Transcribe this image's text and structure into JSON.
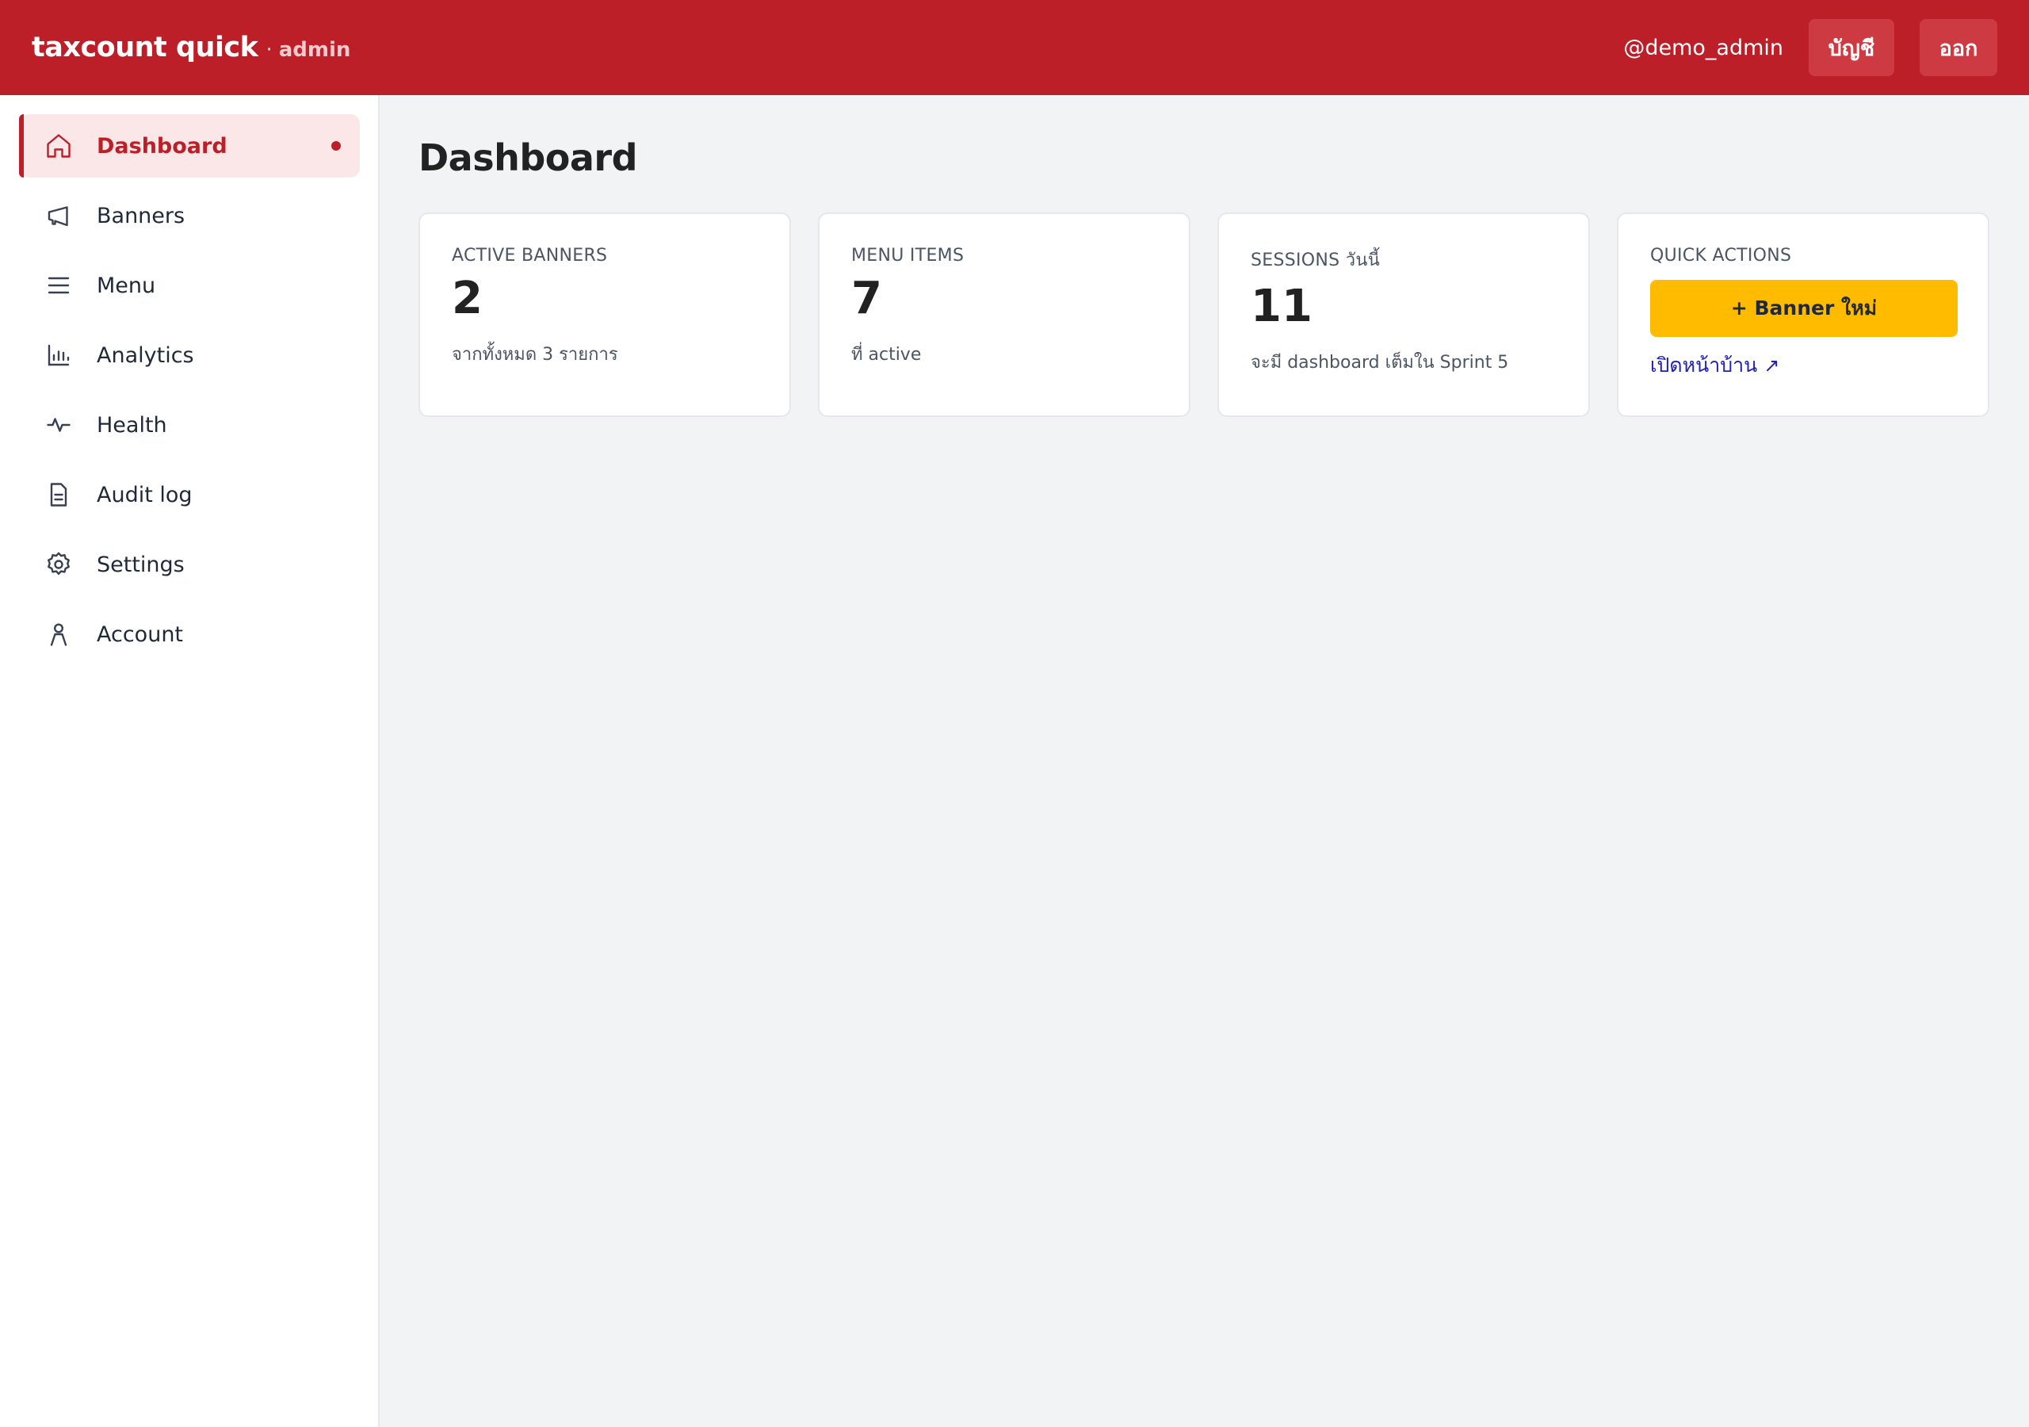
{
  "header": {
    "brand": "taxcount quick",
    "separator": "·",
    "brand_sub": "admin",
    "user_handle": "@demo_admin",
    "account_label": "บัญชี",
    "logout_label": "ออก",
    "brand_color": "#bc1f28"
  },
  "sidebar": {
    "items": [
      {
        "label": "Dashboard",
        "icon": "home-icon",
        "active": true
      },
      {
        "label": "Banners",
        "icon": "megaphone-icon"
      },
      {
        "label": "Menu",
        "icon": "menu-icon"
      },
      {
        "label": "Analytics",
        "icon": "bar-chart-icon"
      },
      {
        "label": "Health",
        "icon": "pulse-icon"
      },
      {
        "label": "Audit log",
        "icon": "document-icon"
      },
      {
        "label": "Settings",
        "icon": "gear-icon"
      },
      {
        "label": "Account",
        "icon": "user-icon"
      }
    ]
  },
  "main": {
    "title": "Dashboard",
    "cards": [
      {
        "label": "ACTIVE BANNERS",
        "value": "2",
        "note": "จากทั้งหมด 3 รายการ"
      },
      {
        "label": "MENU ITEMS",
        "value": "7",
        "note": "ที่ active"
      },
      {
        "label": "SESSIONS วันนี้",
        "value": "11",
        "note": "จะมี dashboard เต็มใน Sprint 5"
      }
    ],
    "quick_actions": {
      "label": "QUICK ACTIONS",
      "new_banner_label": "+ Banner ใหม่",
      "open_home_label": "เปิดหน้าบ้าน",
      "open_home_arrow": "↗",
      "button_color": "#ffbb00",
      "link_color": "#1f1fb8"
    }
  }
}
